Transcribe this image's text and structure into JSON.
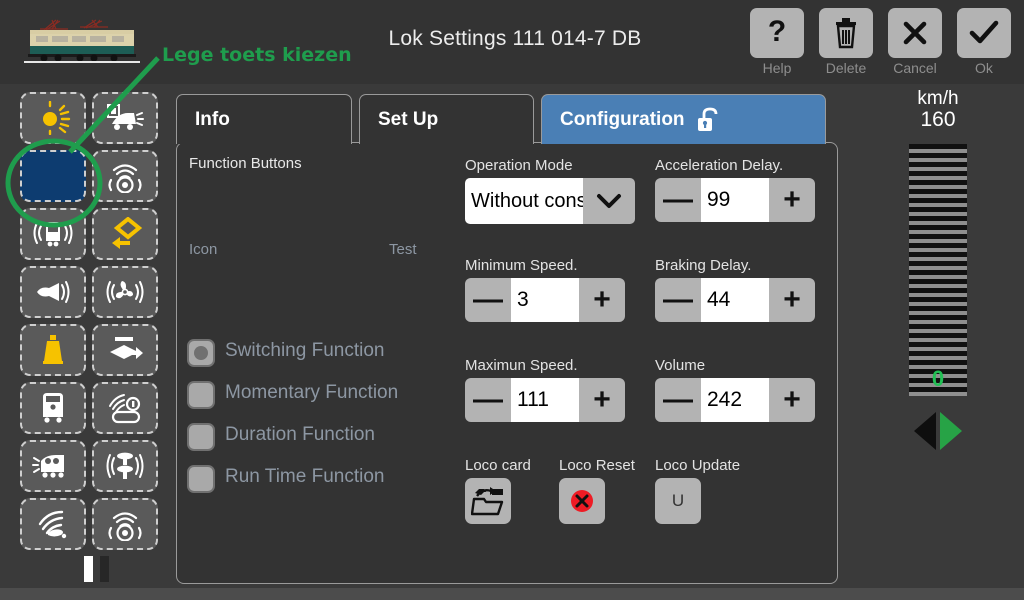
{
  "header": {
    "title": "Lok Settings 111 014-7 DB",
    "loco_icon": "locomotive-image",
    "tools": [
      {
        "name": "help",
        "label": "Help",
        "icon": "question-mark-icon"
      },
      {
        "name": "delete",
        "label": "Delete",
        "icon": "trash-icon"
      },
      {
        "name": "cancel",
        "label": "Cancel",
        "icon": "close-x-icon"
      },
      {
        "name": "ok",
        "label": "Ok",
        "icon": "checkmark-icon"
      }
    ]
  },
  "annotation": {
    "text": "Lege toets kiezen",
    "color": "#1f9d4d"
  },
  "function_buttons": {
    "items": [
      {
        "icon": "sun-light-icon",
        "selected": false
      },
      {
        "icon": "train-headlight-icon",
        "selected": false
      },
      {
        "icon": "empty-blue-key",
        "selected": true
      },
      {
        "icon": "wifi-speaker-icon",
        "selected": false
      },
      {
        "icon": "train-sound-waves-icon",
        "selected": false
      },
      {
        "icon": "yellow-coupler-icon",
        "selected": false
      },
      {
        "icon": "horn-icon",
        "selected": false
      },
      {
        "icon": "fan-sound-icon",
        "selected": false
      },
      {
        "icon": "yellow-bell-icon",
        "selected": false
      },
      {
        "icon": "pantograph-arrow-icon",
        "selected": false
      },
      {
        "icon": "train-front-icon",
        "selected": false
      },
      {
        "icon": "cab-radio-icon",
        "selected": false
      },
      {
        "icon": "rail-grinder-icon",
        "selected": false
      },
      {
        "icon": "steam-release-icon",
        "selected": false
      },
      {
        "icon": "signal-hand-icon",
        "selected": false
      },
      {
        "icon": "speaker-wave-icon",
        "selected": false
      }
    ],
    "page_dots": [
      {
        "state": "on"
      },
      {
        "state": "off"
      }
    ],
    "selected_color": "#0d3c70"
  },
  "tabs": [
    {
      "label": "Info",
      "active": false,
      "icon": null
    },
    {
      "label": "Set Up",
      "active": false,
      "icon": null
    },
    {
      "label": "Configuration",
      "active": true,
      "icon": "unlock-padlock-icon",
      "color": "#4a7fb5"
    }
  ],
  "panel": {
    "section_title": "Function Buttons",
    "column_icon": "Icon",
    "column_test": "Test",
    "radio_options": [
      {
        "label": "Switching Function",
        "selected": true
      },
      {
        "label": "Momentary Function",
        "selected": false
      },
      {
        "label": "Duration Function",
        "selected": false
      },
      {
        "label": "Run Time Function",
        "selected": false
      }
    ],
    "fields": {
      "operation_mode": {
        "label": "Operation Mode",
        "value": "Without cons",
        "type": "select"
      },
      "acceleration_delay": {
        "label": "Acceleration Delay.",
        "value": "99",
        "type": "spinner"
      },
      "minimum_speed": {
        "label": "Minimum Speed.",
        "value": "3",
        "type": "spinner"
      },
      "braking_delay": {
        "label": "Braking Delay.",
        "value": "44",
        "type": "spinner"
      },
      "maximum_speed": {
        "label": "Maximun Speed.",
        "value": "111",
        "type": "spinner"
      },
      "volume": {
        "label": "Volume",
        "value": "242",
        "type": "spinner"
      }
    },
    "actions": {
      "loco_card": {
        "label": "Loco card",
        "icon": "folder-train-export-icon"
      },
      "loco_reset": {
        "label": "Loco Reset",
        "icon": "red-x-circle-icon"
      },
      "loco_update": {
        "label": "Loco Update",
        "icon": "U"
      }
    },
    "spinner_minus": "—",
    "spinner_plus": "+"
  },
  "gauge": {
    "unit": "km/h",
    "max_speed": "160",
    "current_speed": "0",
    "speed_color": "#22c055",
    "direction_backward_icon": "arrow-left-icon",
    "direction_forward_icon": "arrow-right-icon",
    "forward_active_color": "#27a346"
  }
}
